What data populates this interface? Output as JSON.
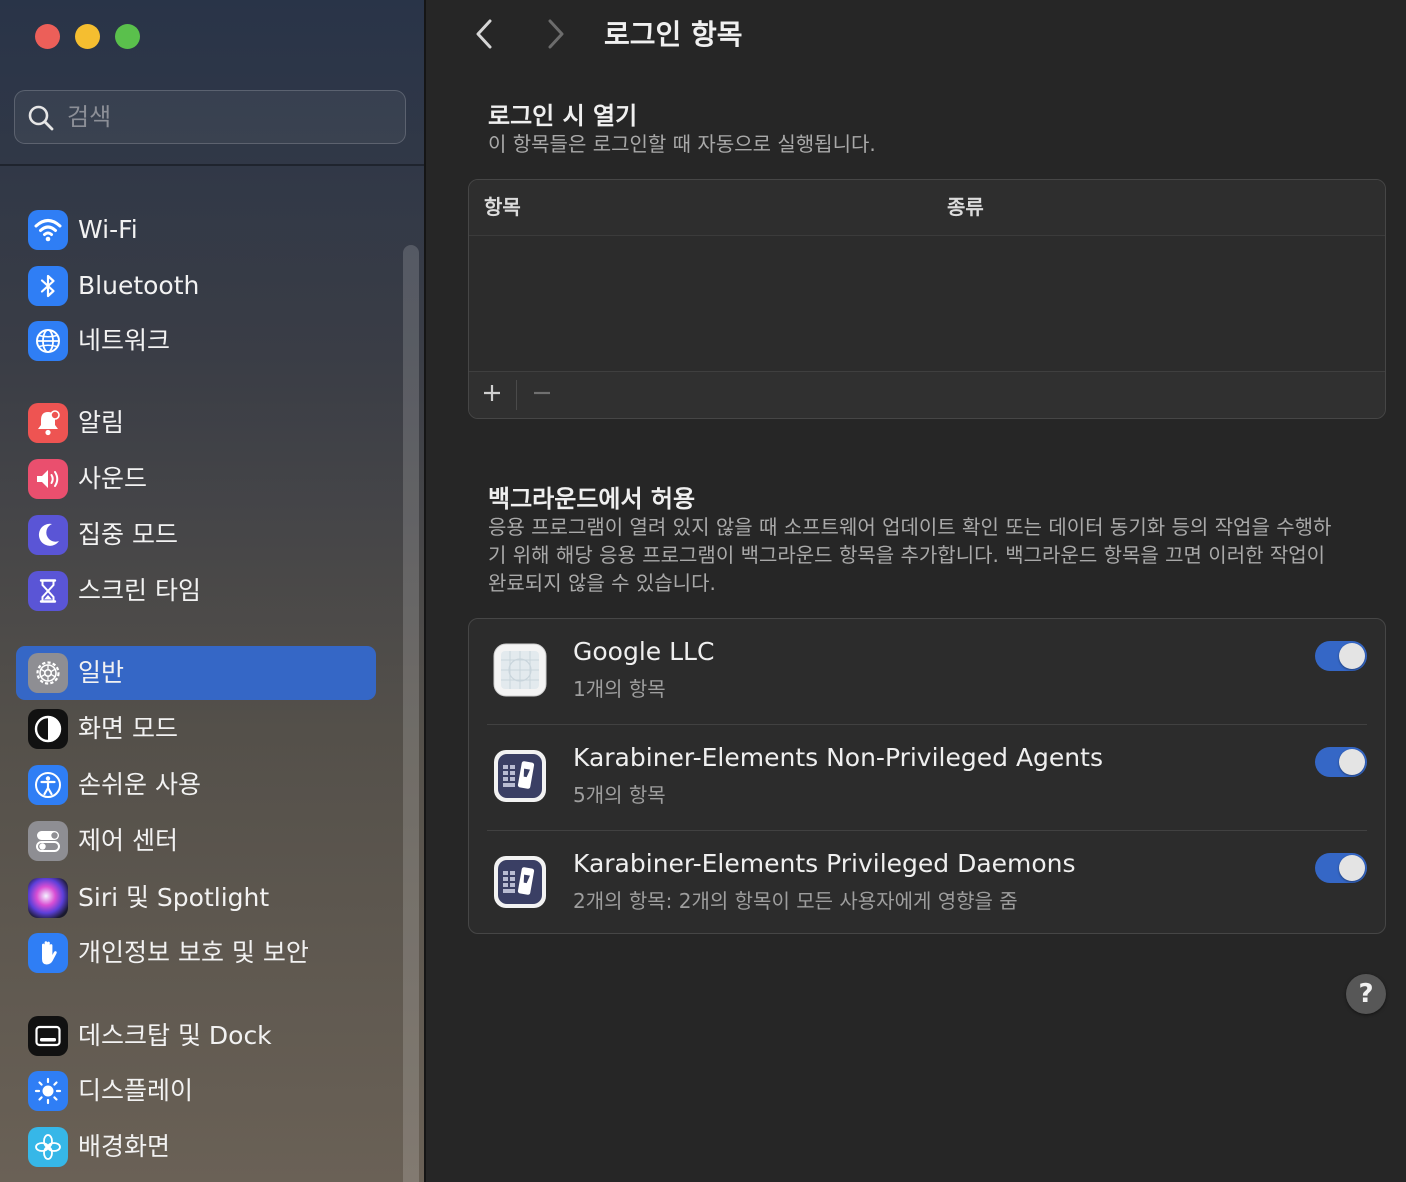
{
  "colors": {
    "accent": "#3567c6",
    "traffic_red": "#ec5f59",
    "traffic_yellow": "#f5be30",
    "traffic_green": "#5ac04c"
  },
  "sidebar": {
    "search": {
      "placeholder": "검색",
      "icon": "magnifying-glass-icon"
    },
    "items": [
      {
        "label": "Wi-Fi",
        "icon": "wifi-icon"
      },
      {
        "label": "Bluetooth",
        "icon": "bluetooth-icon"
      },
      {
        "label": "네트워크",
        "icon": "globe-icon"
      },
      {
        "label": "알림",
        "icon": "bell-icon"
      },
      {
        "label": "사운드",
        "icon": "speaker-icon"
      },
      {
        "label": "집중 모드",
        "icon": "moon-icon"
      },
      {
        "label": "스크린 타임",
        "icon": "hourglass-icon"
      },
      {
        "label": "일반",
        "icon": "gear-icon",
        "selected": true
      },
      {
        "label": "화면 모드",
        "icon": "appearance-icon"
      },
      {
        "label": "손쉬운 사용",
        "icon": "accessibility-icon"
      },
      {
        "label": "제어 센터",
        "icon": "toggles-icon"
      },
      {
        "label": "Siri 및 Spotlight",
        "icon": "siri-icon"
      },
      {
        "label": "개인정보 보호 및 보안",
        "icon": "hand-icon"
      },
      {
        "label": "데스크탑 및 Dock",
        "icon": "dock-icon"
      },
      {
        "label": "디스플레이",
        "icon": "sun-icon"
      },
      {
        "label": "배경화면",
        "icon": "flower-icon"
      }
    ]
  },
  "main": {
    "title": "로그인 항목",
    "login_section": {
      "title": "로그인 시 열기",
      "description": "이 항목들은 로그인할 때 자동으로 실행됩니다.",
      "columns": [
        "항목",
        "종류"
      ],
      "add_label": "+",
      "remove_label": "−"
    },
    "background_section": {
      "title": "백그라운드에서 허용",
      "description": "응용 프로그램이 열려 있지 않을 때 소프트웨어 업데이트 확인 또는 데이터 동기화 등의 작업을 수행하기 위해 해당 응용 프로그램이 백그라운드 항목을 추가합니다. 백그라운드 항목을 끄면 이러한 작업이 완료되지 않을 수 있습니다.",
      "items": [
        {
          "name": "Google LLC",
          "detail": "1개의 항목",
          "enabled": true
        },
        {
          "name": "Karabiner-Elements Non-Privileged Agents",
          "detail": "5개의 항목",
          "enabled": true
        },
        {
          "name": "Karabiner-Elements Privileged Daemons",
          "detail": "2개의 항목: 2개의 항목이 모든 사용자에게 영향을 줌",
          "enabled": true
        }
      ]
    },
    "help_label": "?"
  }
}
